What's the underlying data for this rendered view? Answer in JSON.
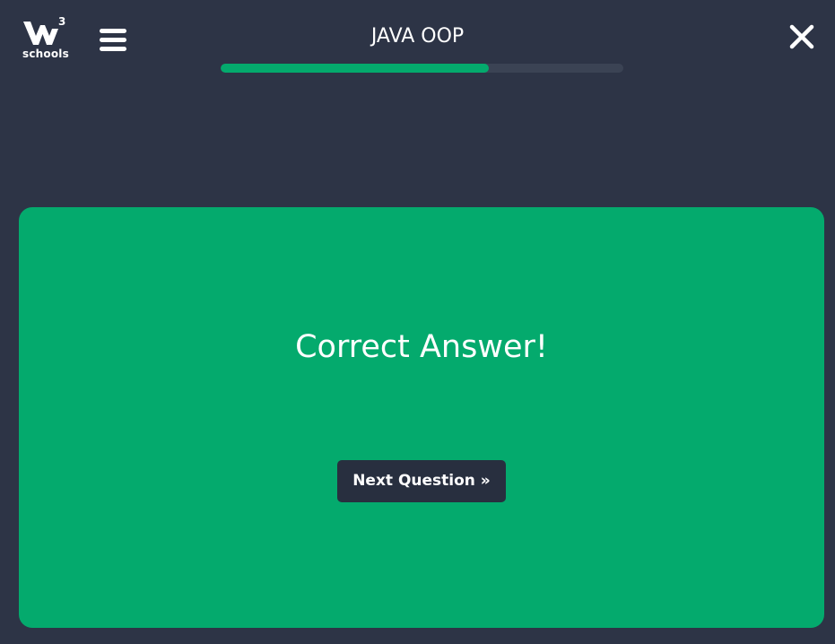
{
  "header": {
    "logo_text": "schools",
    "logo_superscript": "3",
    "title": "JAVA OOP",
    "progress_percent": 66.5
  },
  "result": {
    "message": "Correct Answer!",
    "next_label": "Next Question »"
  },
  "colors": {
    "background": "#2d3446",
    "accent_green": "#04aa6d",
    "progress_track": "#3b4354",
    "button_dark": "#282f3f"
  },
  "icons": {
    "logo": "w3schools-logo",
    "menu": "hamburger-menu-icon",
    "close": "close-icon"
  }
}
